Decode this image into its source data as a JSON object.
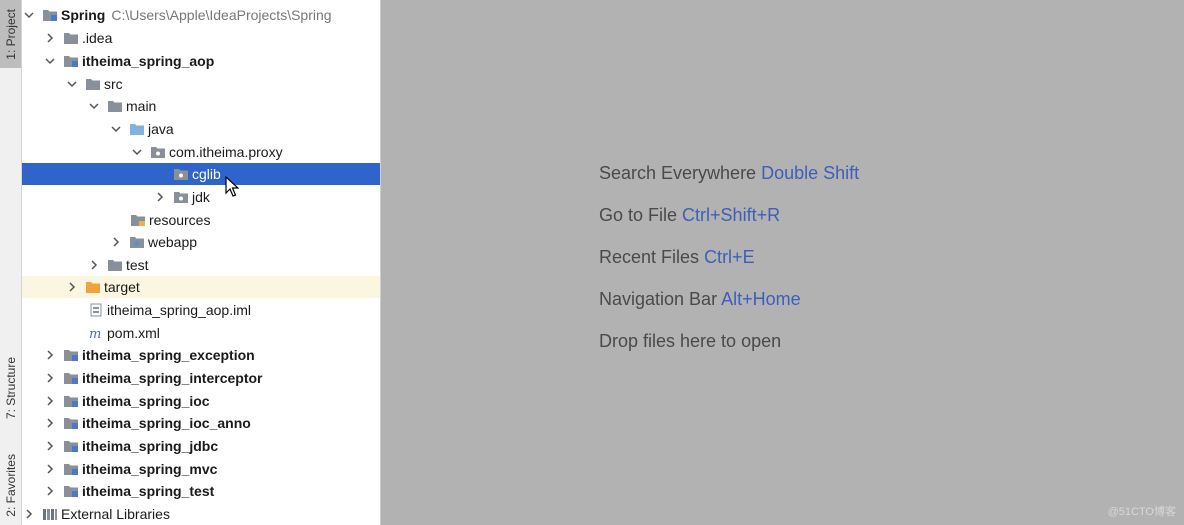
{
  "tool_strip": {
    "project_tab": "1: Project",
    "structure_tab": "7: Structure",
    "favorites_tab": "2: Favorites"
  },
  "tree": {
    "root": {
      "label": "Spring",
      "path": "C:\\Users\\Apple\\IdeaProjects\\Spring"
    },
    "items": [
      {
        "label": ".idea"
      },
      {
        "label": "itheima_spring_aop"
      },
      {
        "label": "src"
      },
      {
        "label": "main"
      },
      {
        "label": "java"
      },
      {
        "label": "com.itheima.proxy"
      },
      {
        "label": "cglib"
      },
      {
        "label": "jdk"
      },
      {
        "label": "resources"
      },
      {
        "label": "webapp"
      },
      {
        "label": "test"
      },
      {
        "label": "target"
      },
      {
        "label": "itheima_spring_aop.iml"
      },
      {
        "label": "pom.xml"
      },
      {
        "label": "itheima_spring_exception"
      },
      {
        "label": "itheima_spring_interceptor"
      },
      {
        "label": "itheima_spring_ioc"
      },
      {
        "label": "itheima_spring_ioc_anno"
      },
      {
        "label": "itheima_spring_jdbc"
      },
      {
        "label": "itheima_spring_mvc"
      },
      {
        "label": "itheima_spring_test"
      },
      {
        "label": "External Libraries"
      }
    ]
  },
  "editor_hints": [
    {
      "text": "Search Everywhere",
      "key": "Double Shift"
    },
    {
      "text": "Go to File",
      "key": "Ctrl+Shift+R"
    },
    {
      "text": "Recent Files",
      "key": "Ctrl+E"
    },
    {
      "text": "Navigation Bar",
      "key": "Alt+Home"
    },
    {
      "text": "Drop files here to open",
      "key": ""
    }
  ],
  "watermark": "@51CTO博客",
  "colors": {
    "selection": "#2f65ca",
    "editor_bg": "#b2b2b2",
    "shortcut": "#3d5fb8",
    "folder": "#8a9099",
    "source_folder": "#7eb3e0",
    "excluded_folder": "#f0a33a"
  }
}
